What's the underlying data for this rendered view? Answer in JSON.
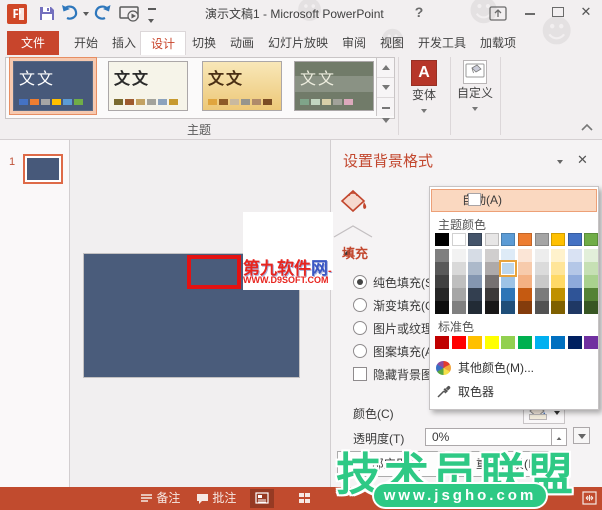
{
  "titlebar": {
    "title": "演示文稿1 - Microsoft PowerPoint",
    "help_glyph": "?",
    "close_glyph": "✕",
    "ppt_glyph": "P"
  },
  "tabs": {
    "file": "文件",
    "items": [
      "开始",
      "插入",
      "设计",
      "切换",
      "动画",
      "幻灯片放映",
      "审阅",
      "视图",
      "开发工具",
      "加载项"
    ],
    "selected": "设计"
  },
  "ribbon": {
    "group_label": "主题",
    "theme_text": "文文",
    "variants_label": "变体",
    "variants_icon_glyph": "A",
    "customize_label": "自定义",
    "theme_swatches": [
      [
        "#4472C4",
        "#ED7D31",
        "#A5A5A5",
        "#FFC000",
        "#5B9BD5",
        "#70AD47"
      ],
      [
        "#7A6A2F",
        "#9E5B30",
        "#C3A262",
        "#A3A39B",
        "#8CA3BD",
        "#C79A2E"
      ],
      [
        "#E0A53E",
        "#8E5B28",
        "#C9B99F",
        "#96958D",
        "#B08A6A",
        "#7B4C24"
      ],
      [
        "#7FA489",
        "#C2D6C0",
        "#D8CFA8",
        "#A2A29A",
        "#DCA9BC"
      ]
    ]
  },
  "slide_panel": {
    "slide_number": "1"
  },
  "panel": {
    "title": "设置背景格式",
    "fill_header": "填充",
    "fill_options": [
      {
        "label": "纯色填充(S)",
        "selected": true
      },
      {
        "label": "渐变填充(G)",
        "selected": false
      },
      {
        "label": "图片或纹理填充(P)",
        "selected": false
      },
      {
        "label": "图案填充(A)",
        "selected": false
      }
    ],
    "hide_bg_label": "隐藏背景图形(H)",
    "color_label": "颜色(C)",
    "transparency_label": "透明度(T)",
    "transparency_value": "0%",
    "apply_all_label": "全部应用(L)",
    "reset_label": "重置背景(B)"
  },
  "dropdown": {
    "auto_label": "自动(A)",
    "theme_label": "主题颜色",
    "standard_label": "标准色",
    "more_label": "其他颜色(M)...",
    "eyedropper_label": "取色器",
    "selected_cell": {
      "col": 4,
      "row": 1
    },
    "theme_columns": [
      [
        "#000000",
        "#7F7F7F",
        "#595959",
        "#404040",
        "#262626",
        "#0D0D0D"
      ],
      [
        "#FFFFFF",
        "#F2F2F2",
        "#D9D9D9",
        "#BFBFBF",
        "#A6A6A6",
        "#808080"
      ],
      [
        "#44546A",
        "#D6DCE5",
        "#ACB9CA",
        "#8496B0",
        "#333F50",
        "#222B35"
      ],
      [
        "#E7E6E6",
        "#D0CECE",
        "#AEAAAA",
        "#767171",
        "#3B3838",
        "#181717"
      ],
      [
        "#5B9BD5",
        "#DEEBF7",
        "#BDD7EE",
        "#9DC3E6",
        "#2E75B6",
        "#1F4E79"
      ],
      [
        "#ED7D31",
        "#FBE5D6",
        "#F7CBAC",
        "#F4B183",
        "#C55A11",
        "#843C0C"
      ],
      [
        "#A5A5A5",
        "#EDEDED",
        "#DBDBDB",
        "#C9C9C9",
        "#7B7B7B",
        "#525252"
      ],
      [
        "#FFC000",
        "#FFF2CC",
        "#FFE599",
        "#FFD966",
        "#BF9000",
        "#7F6000"
      ],
      [
        "#4472C4",
        "#D9E2F3",
        "#B4C7E7",
        "#8EAADB",
        "#2F5497",
        "#1F3864"
      ],
      [
        "#70AD47",
        "#E2EFDA",
        "#C6E0B4",
        "#A9D18E",
        "#548235",
        "#375623"
      ]
    ],
    "standard_colors": [
      "#C00000",
      "#FF0000",
      "#FFC000",
      "#FFFF00",
      "#92D050",
      "#00B050",
      "#00B0F0",
      "#0070C0",
      "#002060",
      "#7030A0"
    ]
  },
  "statusbar": {
    "notes_label": "备注",
    "comments_label": "批注"
  },
  "watermarks": {
    "red_line1_part1": "第九软件",
    "red_line1_part2": "网",
    "red_line1_dash": "-",
    "red_line2": "WWW.D9SOFT.COM",
    "green_line1": "技术员联盟",
    "green_line2": "www.jsgho.com"
  },
  "colors": {
    "accent_red": "#C8452C",
    "slide_blue": "#4A5C7B",
    "statusbar_bg": "#C14B2E",
    "watermark_green": "#2EC985",
    "watermark_red": "#E8251F",
    "annotation_red": "#E31212"
  }
}
